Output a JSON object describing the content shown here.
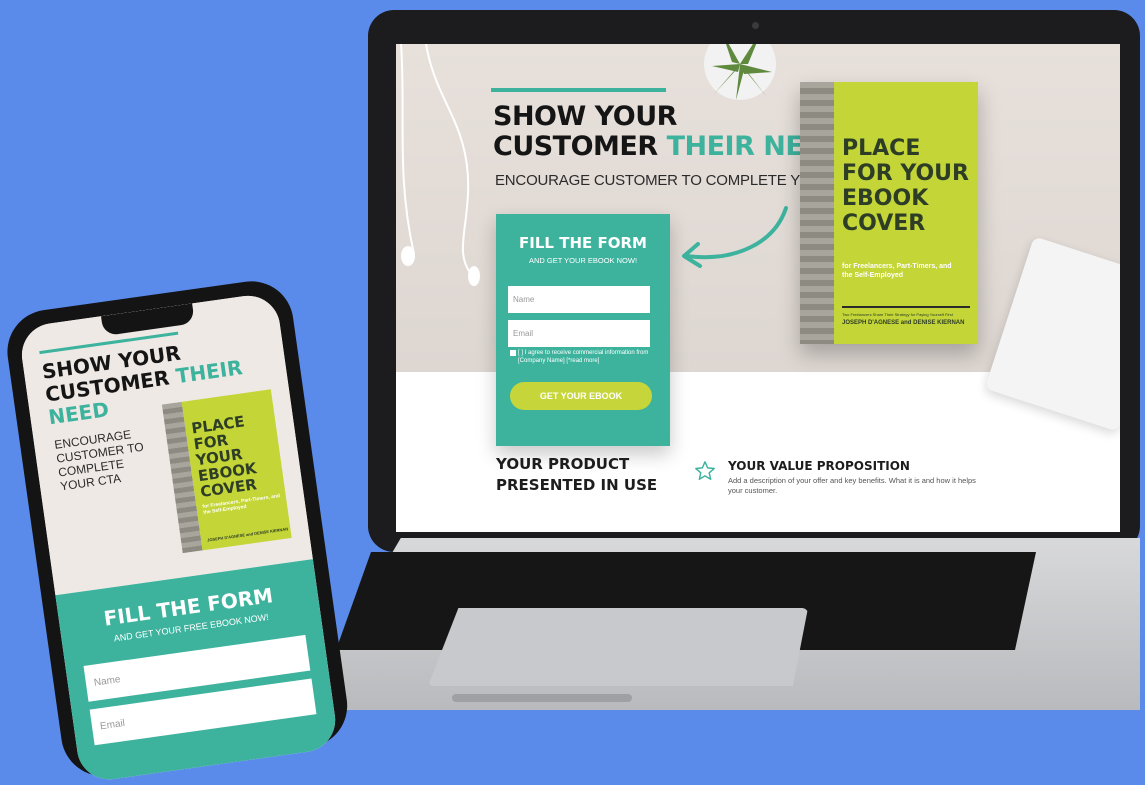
{
  "laptop_page": {
    "hero": {
      "title_line1": "SHOW YOUR",
      "title_line2_dark": "CUSTOMER",
      "title_line2_accent": "THEIR NEED",
      "subtitle": "ENCOURAGE CUSTOMER TO COMPLETE YOUR CTA"
    },
    "form": {
      "title": "FILL THE FORM",
      "subtitle": "AND GET YOUR EBOOK NOW!",
      "name_placeholder": "Name",
      "email_placeholder": "Email",
      "consent": "[ ] I agree to receive commercial information from [Company Name] [*read more]",
      "button": "GET YOUR EBOOK"
    },
    "ebook": {
      "title_line1": "PLACE",
      "title_line2": "FOR YOUR",
      "title_line3": "EBOOK",
      "title_line4": "COVER",
      "subtitle": "for Freelancers, Part-Timers, and the Self-Employed",
      "tagline": "Two Freelancers Share Their Strategy for Paying Yourself First",
      "authors": "JOSEPH D'AGNESE and DENISE KIERNAN"
    },
    "product": {
      "title_line1": "YOUR PRODUCT",
      "title_line2": "PRESENTED IN USE"
    },
    "value": {
      "title": "YOUR VALUE PROPOSITION",
      "description": "Add a description of your offer and key benefits. What it is and how it helps your customer."
    }
  },
  "phone_page": {
    "hero": {
      "title_line1": "SHOW YOUR",
      "title_line2_dark": "CUSTOMER",
      "title_line2_accent": "THEIR",
      "title_line3_accent": "NEED",
      "subtitle": "ENCOURAGE CUSTOMER TO COMPLETE YOUR CTA"
    },
    "ebook": {
      "title_line1": "PLACE",
      "title_line2": "FOR YOUR",
      "title_line3": "EBOOK",
      "title_line4": "COVER",
      "subtitle": "for Freelancers, Part-Timers, and the Self-Employed",
      "authors": "JOSEPH D'AGNESE and DENISE KIERNAN"
    },
    "form": {
      "title": "FILL THE FORM",
      "subtitle": "AND GET YOUR FREE EBOOK NOW!",
      "name_placeholder": "Name",
      "email_placeholder": "Email"
    }
  },
  "colors": {
    "background": "#5b8bea",
    "accent_teal": "#3db39e",
    "ebook_green": "#c3d537",
    "button_lime": "#c6d63a"
  },
  "icons": [
    "star-icon",
    "arrow-icon",
    "plant-icon"
  ]
}
